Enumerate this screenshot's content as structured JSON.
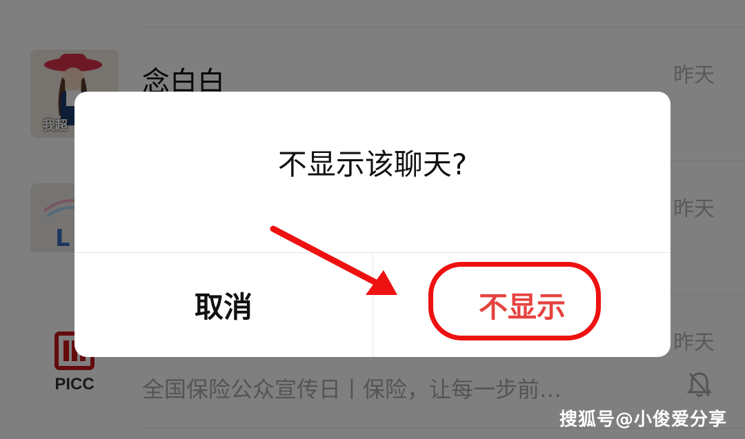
{
  "chat_list": {
    "rows": [
      {
        "name": "念白白",
        "time": "昨天",
        "avatar_text": "我超"
      },
      {
        "name": "",
        "time": "昨天",
        "avatar_text": "L"
      },
      {
        "name": "",
        "time": "昨天",
        "avatar_text": "PICC",
        "preview": "全国保险公众宣传日丨保险，让每一步前…"
      }
    ]
  },
  "dialog": {
    "title": "不显示该聊天?",
    "cancel_label": "取消",
    "hide_label": "不显示"
  },
  "watermark": "搜狐号@小俊爱分享",
  "colors": {
    "danger": "#e64340",
    "annotation": "#ee1111",
    "overlay": "rgba(0,0,0,0.5)"
  },
  "icons": {
    "mute": "bell-off-icon",
    "annotation_arrow": "arrow-icon"
  }
}
